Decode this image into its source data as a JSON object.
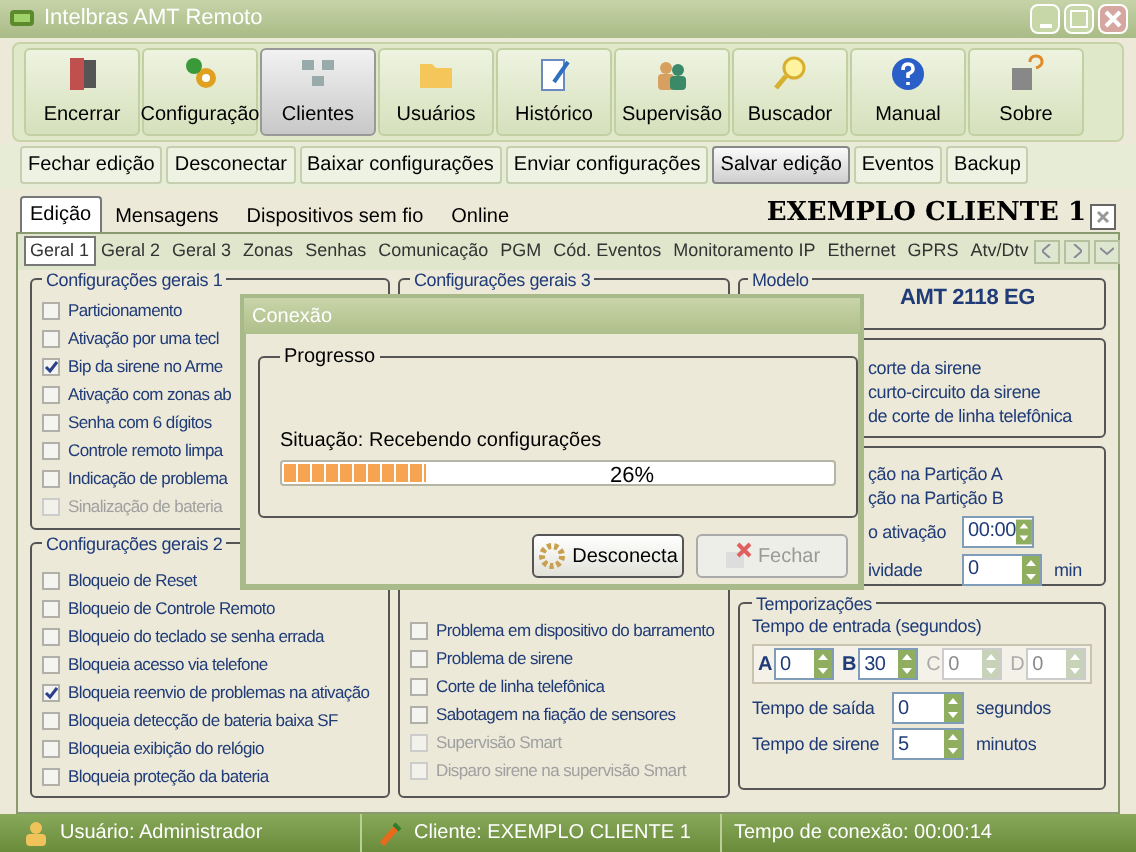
{
  "window": {
    "title": "Intelbras AMT Remoto"
  },
  "toolbar": [
    {
      "label": "Encerrar",
      "selected": false
    },
    {
      "label": "Configuração",
      "selected": false
    },
    {
      "label": "Clientes",
      "selected": true
    },
    {
      "label": "Usuários",
      "selected": false
    },
    {
      "label": "Histórico",
      "selected": false
    },
    {
      "label": "Supervisão",
      "selected": false
    },
    {
      "label": "Buscador",
      "selected": false
    },
    {
      "label": "Manual",
      "selected": false
    },
    {
      "label": "Sobre",
      "selected": false
    }
  ],
  "actions": [
    {
      "label": "Fechar edição",
      "selected": false
    },
    {
      "label": "Desconectar",
      "selected": false
    },
    {
      "label": "Baixar configurações",
      "selected": false
    },
    {
      "label": "Enviar configurações",
      "selected": false
    },
    {
      "label": "Salvar edição",
      "selected": true
    },
    {
      "label": "Eventos",
      "selected": false
    },
    {
      "label": "Backup",
      "selected": false
    }
  ],
  "tabs": [
    {
      "label": "Edição",
      "selected": true
    },
    {
      "label": "Mensagens",
      "selected": false
    },
    {
      "label": "Dispositivos sem fio",
      "selected": false
    },
    {
      "label": "Online",
      "selected": false
    }
  ],
  "client_title": "EXEMPLO CLIENTE 1",
  "subtabs": [
    {
      "label": "Geral 1",
      "selected": true
    },
    {
      "label": "Geral 2",
      "selected": false
    },
    {
      "label": "Geral 3",
      "selected": false
    },
    {
      "label": "Zonas",
      "selected": false
    },
    {
      "label": "Senhas",
      "selected": false
    },
    {
      "label": "Comunicação",
      "selected": false
    },
    {
      "label": "PGM",
      "selected": false
    },
    {
      "label": "Cód. Eventos",
      "selected": false
    },
    {
      "label": "Monitoramento IP",
      "selected": false
    },
    {
      "label": "Ethernet",
      "selected": false
    },
    {
      "label": "GPRS",
      "selected": false
    },
    {
      "label": "Atv/Dtv",
      "selected": false
    }
  ],
  "general_1": {
    "title": "Configurações gerais 1",
    "items": [
      {
        "label": "Particionamento",
        "checked": false,
        "disabled": false
      },
      {
        "label": "Ativação por uma tecl",
        "checked": false,
        "disabled": false
      },
      {
        "label": "Bip da sirene no Arme",
        "checked": true,
        "disabled": false
      },
      {
        "label": "Ativação com zonas ab",
        "checked": false,
        "disabled": false
      },
      {
        "label": "Senha com 6 dígitos",
        "checked": false,
        "disabled": false
      },
      {
        "label": "Controle remoto limpa",
        "checked": false,
        "disabled": false
      },
      {
        "label": "Indicação de problema",
        "checked": false,
        "disabled": false
      },
      {
        "label": "Sinalização de bateria",
        "checked": false,
        "disabled": true
      }
    ]
  },
  "general_2": {
    "title": "Configurações gerais 2",
    "items": [
      {
        "label": "Bloqueio de Reset",
        "checked": false,
        "disabled": false
      },
      {
        "label": "Bloqueio de Controle Remoto",
        "checked": false,
        "disabled": false
      },
      {
        "label": "Bloqueio do teclado se senha errada",
        "checked": false,
        "disabled": false
      },
      {
        "label": "Bloqueia acesso via telefone",
        "checked": false,
        "disabled": false
      },
      {
        "label": "Bloqueia reenvio de problemas na ativação",
        "checked": true,
        "disabled": false
      },
      {
        "label": "Bloqueia detecção de bateria baixa SF",
        "checked": false,
        "disabled": false
      },
      {
        "label": "Bloqueia exibição do relógio",
        "checked": false,
        "disabled": false
      },
      {
        "label": "Bloqueia proteção da bateria",
        "checked": false,
        "disabled": false
      }
    ]
  },
  "general_3": {
    "title": "Configurações gerais 3",
    "items": [
      {
        "label": "Problema em dispositivo do barramento",
        "checked": false,
        "disabled": false
      },
      {
        "label": "Problema de sirene",
        "checked": false,
        "disabled": false
      },
      {
        "label": "Corte de linha telefônica",
        "checked": false,
        "disabled": false
      },
      {
        "label": "Sabotagem na fiação de sensores",
        "checked": false,
        "disabled": false
      },
      {
        "label": "Supervisão Smart",
        "checked": false,
        "disabled": true
      },
      {
        "label": "Disparo sirene na supervisão Smart",
        "checked": false,
        "disabled": true
      }
    ]
  },
  "model": {
    "title": "Modelo",
    "value": "AMT 2118 EG"
  },
  "sirene_group": [
    "corte da sirene",
    "curto-circuito da sirene",
    "de corte de linha telefônica"
  ],
  "partition_group": {
    "lines": [
      "ção na Partição A",
      "ção na Partição B"
    ],
    "fields": [
      {
        "label": "o ativação",
        "value": "00:00"
      },
      {
        "label": "ividade",
        "value": "0",
        "unit": "min"
      }
    ]
  },
  "timers": {
    "title": "Temporizações",
    "entry_label": "Tempo de entrada (segundos)",
    "zones": [
      {
        "letter": "A",
        "value": "0",
        "disabled": false
      },
      {
        "letter": "B",
        "value": "30",
        "disabled": false
      },
      {
        "letter": "C",
        "value": "0",
        "disabled": true
      },
      {
        "letter": "D",
        "value": "0",
        "disabled": true
      }
    ],
    "fields": [
      {
        "label": "Tempo de saída",
        "value": "0",
        "unit": "segundos"
      },
      {
        "label": "Tempo de sirene",
        "value": "5",
        "unit": "minutos"
      }
    ]
  },
  "dialog": {
    "title": "Conexão",
    "group": "Progresso",
    "status": "Situação: Recebendo configurações",
    "progress": {
      "level": 0.26,
      "text": "26%"
    },
    "buttons": [
      {
        "label": "Desconecta",
        "disabled": false
      },
      {
        "label": "Fechar",
        "disabled": true
      }
    ]
  },
  "status_bar": {
    "user": "Usuário: Administrador",
    "client": "Cliente: EXEMPLO CLIENTE 1",
    "time": "Tempo de conexão: 00:00:14"
  }
}
